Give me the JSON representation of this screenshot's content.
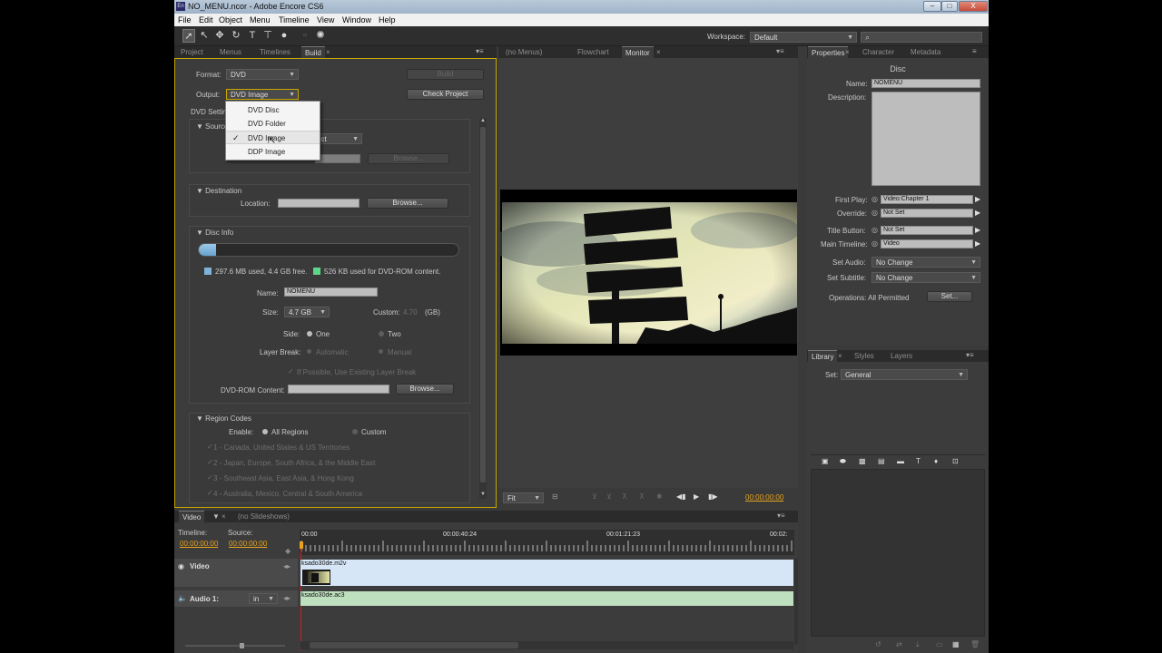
{
  "window": {
    "title": "NO_MENU.ncor - Adobe Encore CS6",
    "app_icon": "En",
    "minimize_glyph": "–",
    "maximize_glyph": "□",
    "close_glyph": "X"
  },
  "menubar": [
    "File",
    "Edit",
    "Object",
    "Menu",
    "Timeline",
    "View",
    "Window",
    "Help"
  ],
  "toolbar": {
    "workspace_label": "Workspace:",
    "workspace_value": "Default",
    "search_placeholder": ""
  },
  "left_panel": {
    "tabs": [
      "Project",
      "Menus",
      "Timelines",
      "Build"
    ],
    "active_tab": "Build",
    "format_label": "Format:",
    "format_value": "DVD",
    "output_label": "Output:",
    "output_value": "DVD Image",
    "build_button": "Build",
    "check_project_button": "Check Project",
    "dvd_settings_label": "DVD Settin",
    "source_header": "Source",
    "source_value_partial": "ect",
    "browse_disabled": "Browse...",
    "output_options": [
      "DVD Disc",
      "DVD Folder",
      "DVD Image",
      "DDP Image"
    ],
    "output_selected_index": 2,
    "destination": {
      "header": "Destination",
      "location_label": "Location:",
      "browse_button": "Browse..."
    },
    "disc_info": {
      "header": "Disc Info",
      "usage_fraction": 0.066,
      "used_text": "297.6 MB used,  4.4 GB free.",
      "rom_text": "526 KB used for DVD-ROM content.",
      "used_color": "#7fb2d8",
      "rom_color": "#5ed68a",
      "name_label": "Name:",
      "name_value": "NOMENU",
      "size_label": "Size:",
      "size_value": "4.7 GB",
      "custom_label": "Custom:",
      "custom_value": "4.70",
      "custom_unit": "(GB)",
      "side_label": "Side:",
      "side_one": "One",
      "side_two": "Two",
      "layer_break_label": "Layer Break:",
      "layer_auto": "Automatic",
      "layer_manual": "Manual",
      "existing_layer": "If Possible, Use Existing Layer Break",
      "dvdrom_label": "DVD-ROM Content:",
      "dvdrom_browse": "Browse..."
    },
    "region_codes": {
      "header": "Region Codes",
      "enable_label": "Enable:",
      "all_regions": "All Regions",
      "custom": "Custom",
      "regions": [
        "1 - Canada, United States & US Territories",
        "2 - Japan, Europe, South Africa, & the Middle East",
        "3 - Southeast Asia, East Asia, & Hong Kong",
        "4 - Australia, Mexico, Central & South America"
      ]
    }
  },
  "monitor_panel": {
    "tabs": [
      "(no Menus)",
      "Flowchart",
      "Monitor"
    ],
    "active_tab": "Monitor",
    "fit_value": "Fit",
    "timecode": "00:00:00:00"
  },
  "properties_panel": {
    "tabs": [
      "Properties",
      "Character",
      "Metadata"
    ],
    "active_tab": "Properties",
    "heading": "Disc",
    "name_label": "Name:",
    "name_value": "NOMENU",
    "description_label": "Description:",
    "first_play_label": "First Play:",
    "first_play_value": "Video:Chapter 1",
    "override_label": "Override:",
    "override_value": "Not Set",
    "title_button_label": "Title Button:",
    "title_button_value": "Not Set",
    "main_timeline_label": "Main Timeline:",
    "main_timeline_value": "Video",
    "set_audio_label": "Set Audio:",
    "set_audio_value": "No Change",
    "set_subtitle_label": "Set Subtitle:",
    "set_subtitle_value": "No Change",
    "operations_label": "Operations: All Permitted",
    "set_button": "Set..."
  },
  "library_panel": {
    "tabs": [
      "Library",
      "Styles",
      "Layers"
    ],
    "active_tab": "Library",
    "set_label": "Set:",
    "set_value": "General"
  },
  "timeline_panel": {
    "tab": "Video",
    "slideshow_tab": "(no Slideshows)",
    "timeline_label": "Timeline:",
    "source_label": "Source:",
    "timeline_tc": "00:00:00:00",
    "source_tc": "00:00:00:00",
    "ruler_marks": [
      "00:00",
      "00:00:40:24",
      "00:01:21:23",
      "00:02:"
    ],
    "video_track": "Video",
    "audio_track": "Audio 1:",
    "audio_lang": "in",
    "video_clip": "ksado30de.m2v",
    "audio_clip": "ksado30de.ac3",
    "video_clip_color": "#d6e6f7",
    "audio_clip_color": "#bfe0bf"
  }
}
